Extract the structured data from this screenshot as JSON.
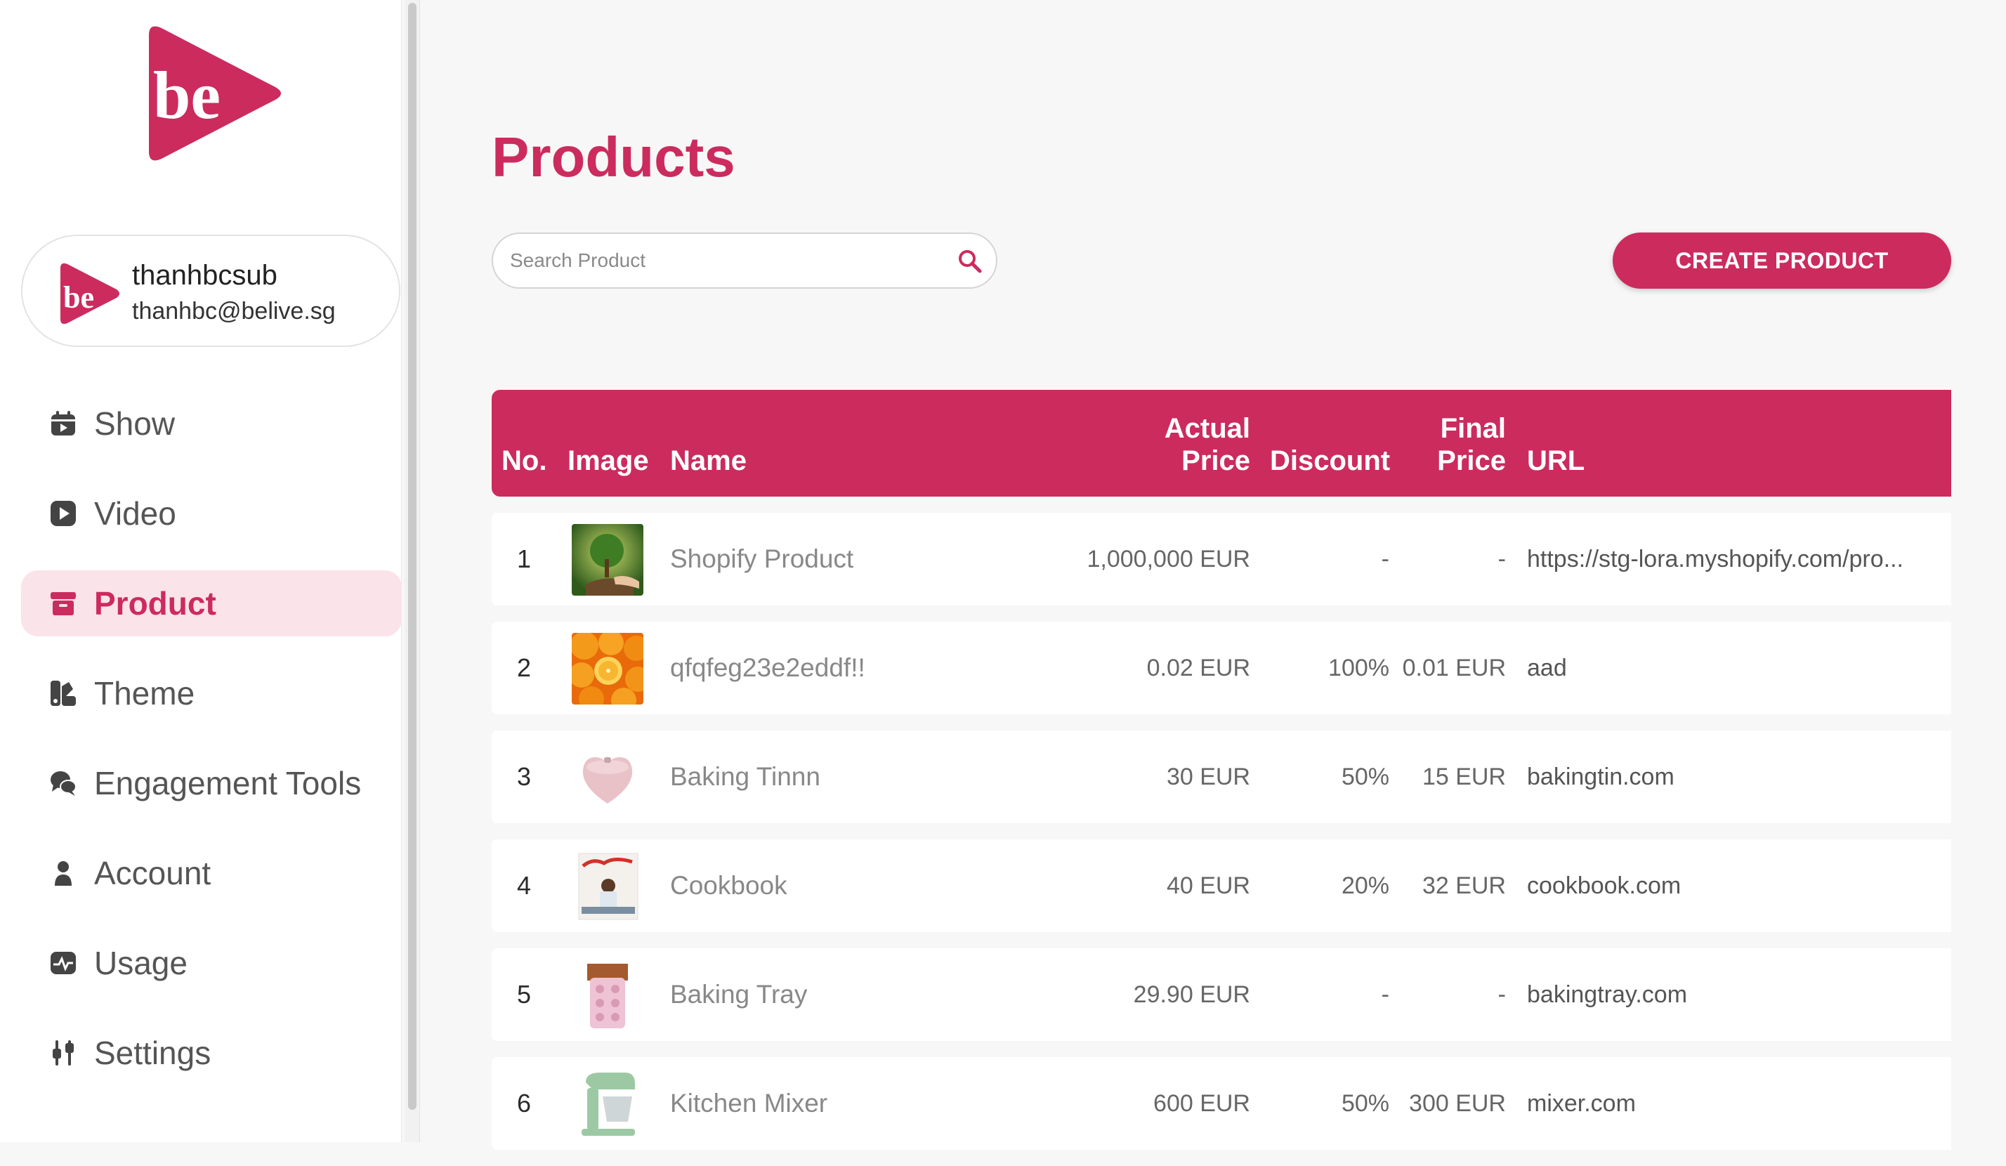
{
  "colors": {
    "brand": "#cc2b5e",
    "active_bg": "#fbe3ea"
  },
  "profile": {
    "name": "thanhbcsub",
    "email": "thanhbc@belive.sg"
  },
  "sidebar": {
    "items": [
      {
        "label": "Show",
        "icon": "calendar-icon",
        "active": false
      },
      {
        "label": "Video",
        "icon": "play-icon",
        "active": false
      },
      {
        "label": "Product",
        "icon": "archive-box-icon",
        "active": true
      },
      {
        "label": "Theme",
        "icon": "palette-icon",
        "active": false
      },
      {
        "label": "Engagement Tools",
        "icon": "chat-bubbles-icon",
        "active": false
      },
      {
        "label": "Account",
        "icon": "person-icon",
        "active": false
      },
      {
        "label": "Usage",
        "icon": "activity-icon",
        "active": false
      },
      {
        "label": "Settings",
        "icon": "sliders-icon",
        "active": false
      }
    ]
  },
  "main": {
    "title": "Products",
    "search": {
      "placeholder": "Search Product",
      "value": ""
    },
    "create_label": "CREATE PRODUCT"
  },
  "table": {
    "headers": {
      "no": "No.",
      "image": "Image",
      "name": "Name",
      "actual_1": "Actual",
      "actual_2": "Price",
      "discount": "Discount",
      "final_1": "Final",
      "final_2": "Price",
      "url": "URL"
    },
    "rows": [
      {
        "no": "1",
        "image": "plant-photo",
        "name": "Shopify Product",
        "actual": "1,000,000 EUR",
        "discount": "-",
        "final": "-",
        "url": "https://stg-lora.myshopify.com/pro..."
      },
      {
        "no": "2",
        "image": "oranges-photo",
        "name": "qfqfeg23e2eddf!!",
        "actual": "0.02 EUR",
        "discount": "100%",
        "final": "0.01 EUR",
        "url": "aad"
      },
      {
        "no": "3",
        "image": "heart-pot-photo",
        "name": "Baking Tinnn",
        "actual": "30 EUR",
        "discount": "50%",
        "final": "15 EUR",
        "url": "bakingtin.com"
      },
      {
        "no": "4",
        "image": "cookbook-photo",
        "name": "Cookbook",
        "actual": "40 EUR",
        "discount": "20%",
        "final": "32 EUR",
        "url": "cookbook.com"
      },
      {
        "no": "5",
        "image": "baking-tray-photo",
        "name": "Baking Tray",
        "actual": "29.90 EUR",
        "discount": "-",
        "final": "-",
        "url": "bakingtray.com"
      },
      {
        "no": "6",
        "image": "mixer-photo",
        "name": "Kitchen Mixer",
        "actual": "600 EUR",
        "discount": "50%",
        "final": "300 EUR",
        "url": "mixer.com"
      }
    ]
  }
}
